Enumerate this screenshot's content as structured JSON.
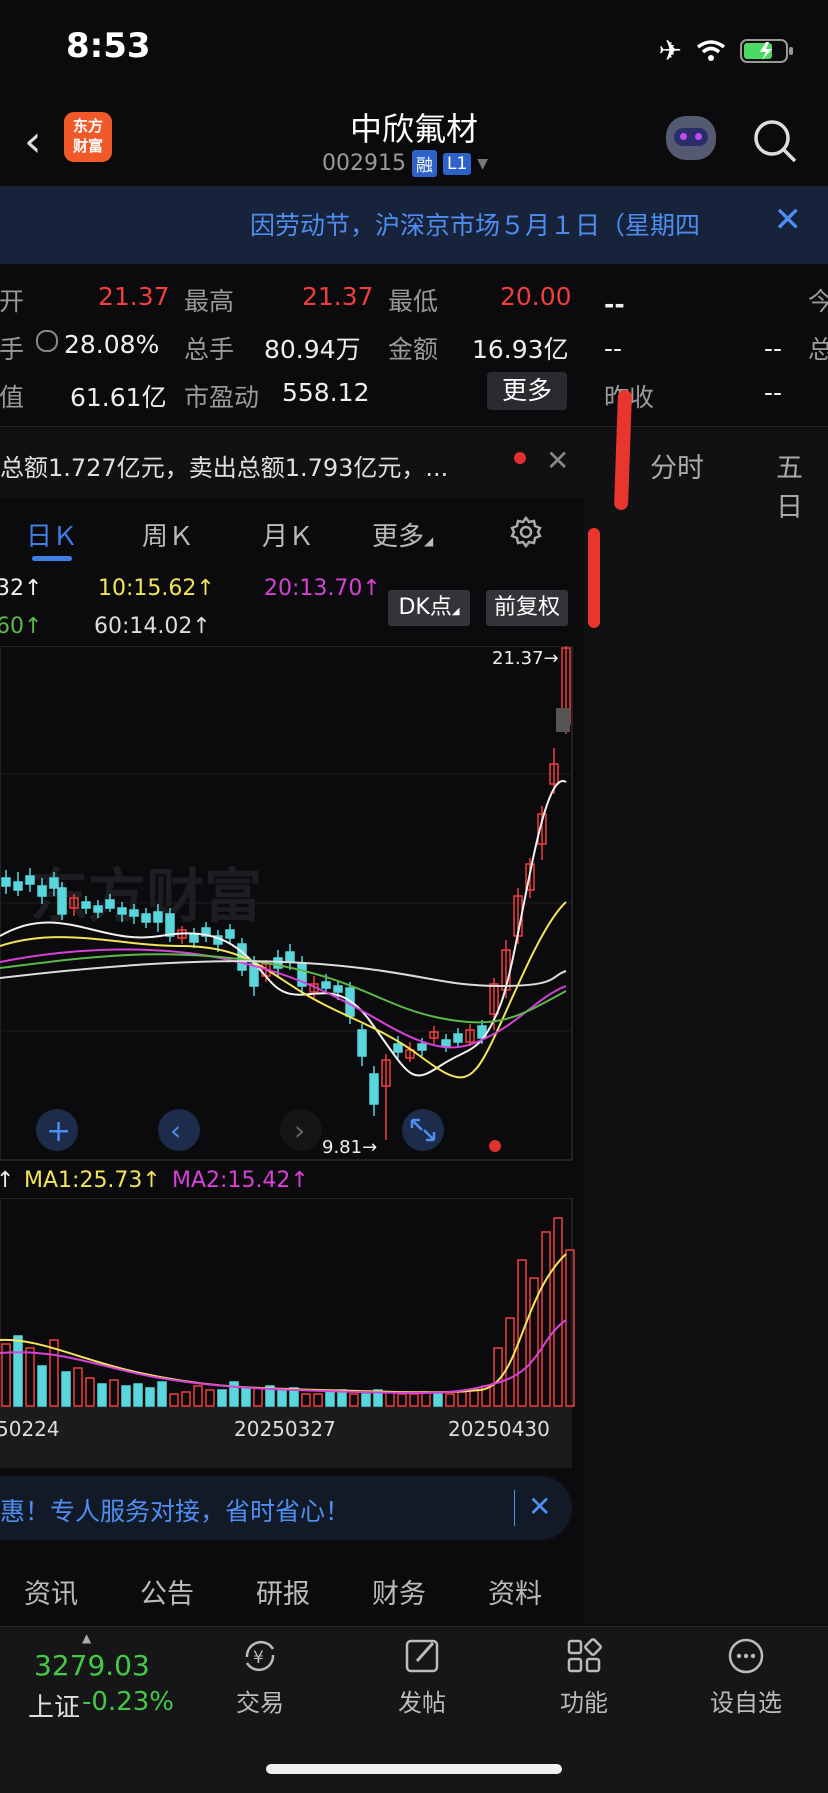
{
  "status": {
    "time": "8:53"
  },
  "header": {
    "logo_text_1": "东方",
    "logo_text_2": "财富",
    "stock_name": "中欣氟材",
    "stock_code": "002915",
    "tag_rong": "融",
    "tag_level": "L1"
  },
  "notice": {
    "text": "因劳动节，沪深京市场５月１日（星期四"
  },
  "quote": {
    "row1": [
      {
        "label": "今开",
        "value": "21.37",
        "color": "red"
      },
      {
        "label": "最高",
        "value": "21.37",
        "color": "red"
      },
      {
        "label": "最低",
        "value": "20.00",
        "color": "red"
      }
    ],
    "row2": [
      {
        "label": "换手",
        "value": "28.08%"
      },
      {
        "label": "总手",
        "value": "80.94万"
      },
      {
        "label": "金额",
        "value": "16.93亿"
      }
    ],
    "row3": [
      {
        "label": "流值",
        "value": "61.61亿"
      },
      {
        "label": "市盈动",
        "value": "558.12"
      }
    ],
    "more_button": "更多",
    "right_col": {
      "r1_value": "--",
      "r1_label": "今",
      "r2_left": "--",
      "r2_mid": "--",
      "r2_label": "总",
      "r3_label": "昨收",
      "r3_value": "--"
    }
  },
  "ticker": {
    "text": "总额1.727亿元，卖出总额1.793亿元，..."
  },
  "ktabs": {
    "day": "日Ｋ",
    "week": "周Ｋ",
    "month": "月Ｋ",
    "more": "更多"
  },
  "ma_main": {
    "ma5": "32↑",
    "ma10": "10:15.62↑",
    "ma20": "20:13.70↑",
    "ma30": "60↑",
    "ma60": "60:14.02↑",
    "btn_dk": "DK点",
    "btn_fq": "前复权"
  },
  "kline": {
    "high_label": "21.37→",
    "low_label": "9.81→",
    "watermark": "东方财富"
  },
  "volume": {
    "ma_prefix": "↑",
    "ma1": "MA1:25.73↑",
    "ma2": "MA2:15.42↑",
    "dates": [
      "50224",
      "20250327",
      "20250430"
    ]
  },
  "right_panel": {
    "tab1": "分时",
    "tab2": "五日"
  },
  "sub_ad": {
    "text": "惠！专人服务对接，省时省心！"
  },
  "info_tabs": [
    "资讯",
    "公告",
    "研报",
    "财务",
    "资料"
  ],
  "bottom_bar": {
    "index_value": "3279.03",
    "index_name": "上证",
    "index_change": "-0.23%",
    "items": [
      "交易",
      "发帖",
      "功能",
      "设自选"
    ]
  },
  "colors": {
    "up": "#ef3e3e",
    "down": "#58d6dc",
    "ma_white": "#f2f2f2",
    "ma_yellow": "#f3e45a",
    "ma_magenta": "#d642d6",
    "ma_green": "#5cb84a",
    "accent": "#3f7fe6"
  }
}
